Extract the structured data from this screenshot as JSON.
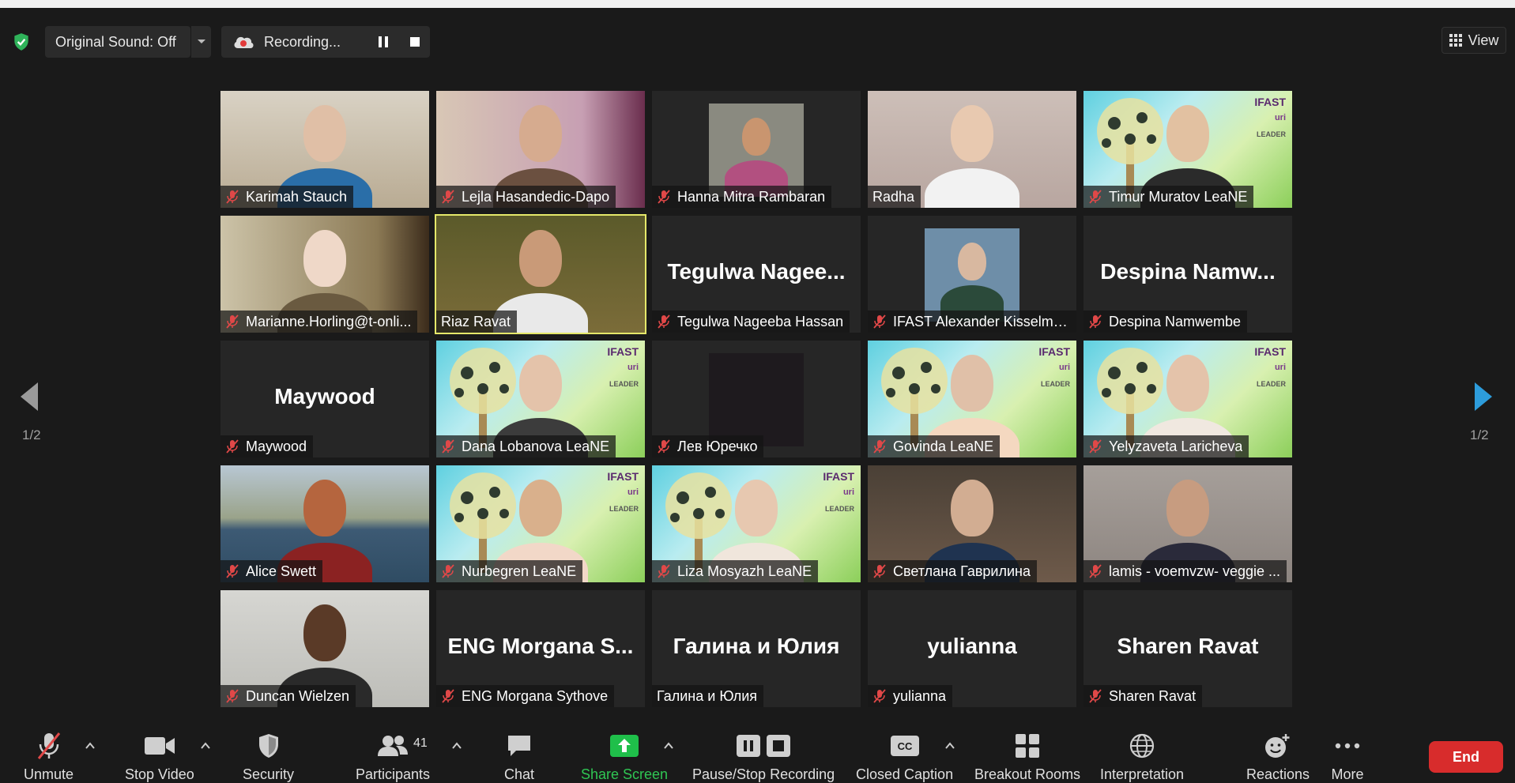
{
  "topbar": {
    "original_sound": "Original Sound: Off",
    "recording": "Recording...",
    "view": "View"
  },
  "pagination": {
    "left": "1/2",
    "right": "1/2"
  },
  "tiles": [
    {
      "name": "Karimah Stauch",
      "muted": true,
      "video": true
    },
    {
      "name": "Lejla Hasandedic-Dapo",
      "muted": true,
      "video": true
    },
    {
      "name": "Hanna Mitra Rambaran",
      "muted": true,
      "video": true
    },
    {
      "name": "Radha",
      "muted": false,
      "video": true
    },
    {
      "name": "Timur Muratov LeaNE",
      "muted": true,
      "video": true
    },
    {
      "name": "Marianne.Horling@t-onli...",
      "muted": true,
      "video": true
    },
    {
      "name": "Riaz Ravat",
      "muted": false,
      "video": true,
      "active": true
    },
    {
      "name": "Tegulwa Nageeba Hassan",
      "big": "Tegulwa  Nagee...",
      "muted": true,
      "video": false
    },
    {
      "name": "IFAST Alexander Kisselma...",
      "muted": true,
      "video": true
    },
    {
      "name": "Despina  Namwembe",
      "big": "Despina   Namw...",
      "muted": true,
      "video": false
    },
    {
      "name": "Maywood",
      "big": "Maywood",
      "muted": true,
      "video": false
    },
    {
      "name": "Dana Lobanova LeaNE",
      "muted": true,
      "video": true
    },
    {
      "name": "Лев Юречко",
      "muted": true,
      "video": true
    },
    {
      "name": "Govinda LeaNE",
      "muted": true,
      "video": true
    },
    {
      "name": "Yelyzaveta Laricheva",
      "muted": true,
      "video": true
    },
    {
      "name": "Alice Swett",
      "muted": true,
      "video": true
    },
    {
      "name": "Nurbegren LeaNE",
      "muted": true,
      "video": true
    },
    {
      "name": "Liza Mosyazh LeaNE",
      "muted": true,
      "video": true
    },
    {
      "name": "Светлана Гаврилина",
      "muted": true,
      "video": true
    },
    {
      "name": "lamis - voemvzw- veggie ...",
      "muted": true,
      "video": true
    },
    {
      "name": "Duncan Wielzen",
      "muted": true,
      "video": true
    },
    {
      "name": "ENG Morgana Sythove",
      "big": "ENG  Morgana  S...",
      "muted": true,
      "video": false
    },
    {
      "name": "Галина и Юлия",
      "big": "Галина и Юлия",
      "muted": false,
      "video": false
    },
    {
      "name": "yulianna",
      "big": "yulianna",
      "muted": true,
      "video": false
    },
    {
      "name": "Sharen Ravat",
      "big": "Sharen Ravat",
      "muted": true,
      "video": false
    }
  ],
  "ifast_logo": {
    "title": "IFAST",
    "sub": "LEADER",
    "uri": "uri"
  },
  "toolbar": {
    "unmute": "Unmute",
    "stop_video": "Stop Video",
    "security": "Security",
    "participants": "Participants",
    "participants_count": "41",
    "chat": "Chat",
    "share_screen": "Share Screen",
    "pause_stop_recording": "Pause/Stop Recording",
    "closed_caption": "Closed Caption",
    "breakout_rooms": "Breakout Rooms",
    "interpretation": "Interpretation",
    "reactions": "Reactions",
    "more": "More",
    "end": "End"
  },
  "colors": {
    "background": "#1a1a1a",
    "tile": "#262626",
    "active_outline": "#e5e86a",
    "share_green": "#1fbf4a",
    "end_red": "#d82c2c",
    "nav_blue": "#2d9cdb",
    "muted_red": "#e04848"
  }
}
